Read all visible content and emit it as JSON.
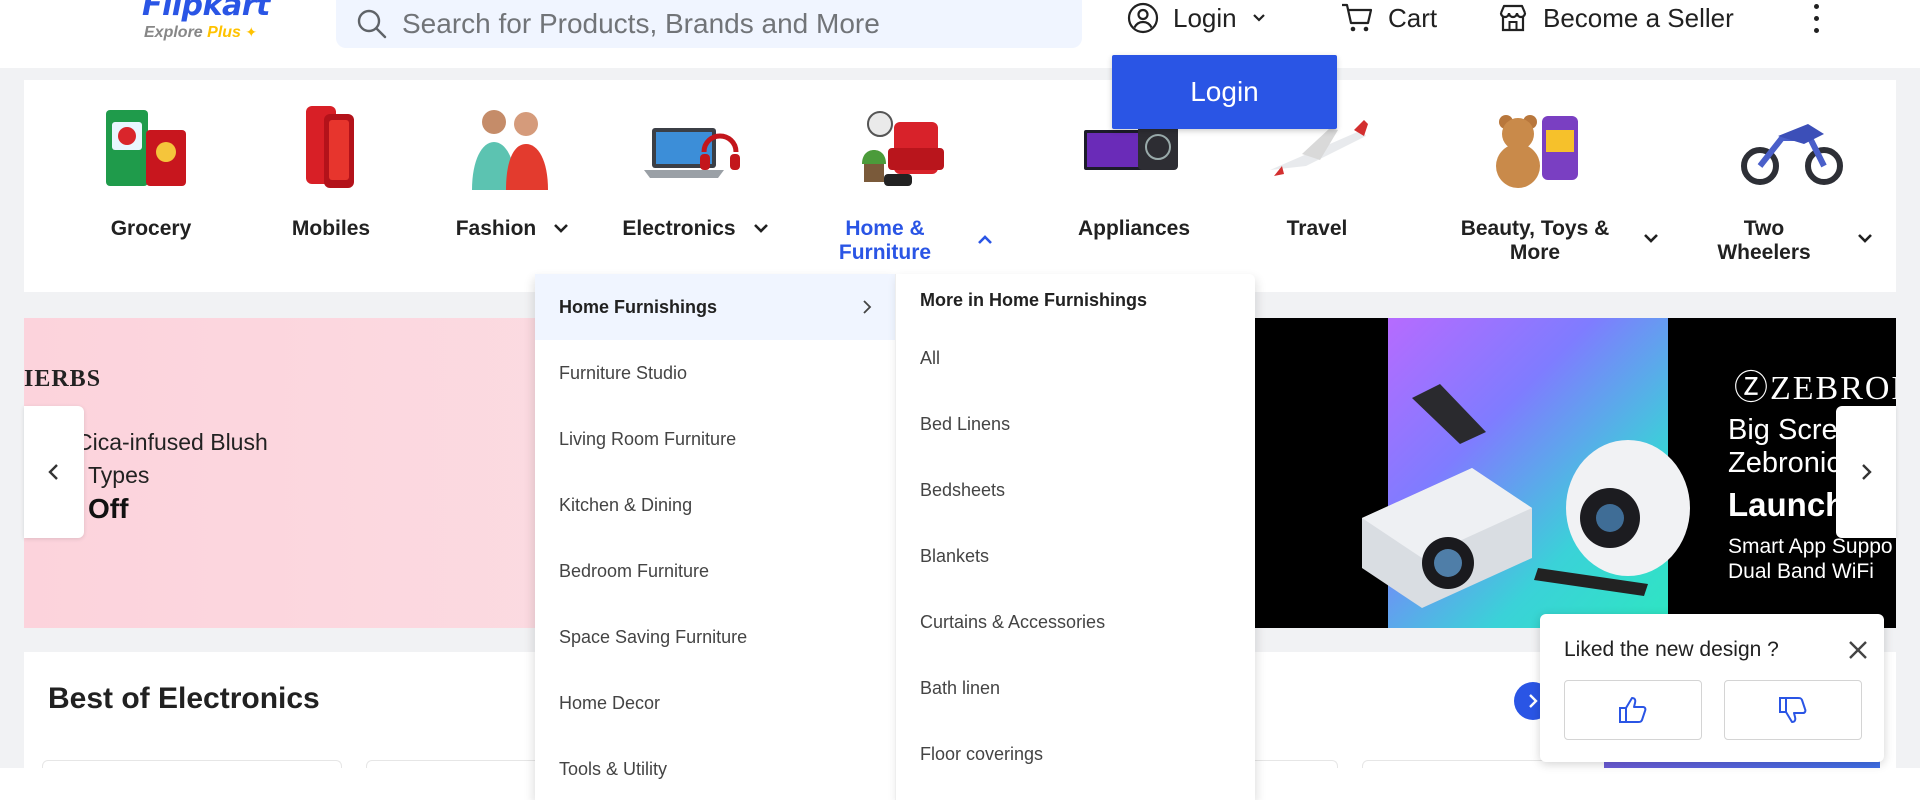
{
  "header": {
    "logo": {
      "brand": "Flipkart",
      "sub_prefix": "Explore",
      "sub_plus": "Plus"
    },
    "search_placeholder": "Search for Products, Brands and More",
    "login_label": "Login",
    "cart_label": "Cart",
    "seller_label": "Become a Seller",
    "login_popup_label": "Login"
  },
  "categories": [
    {
      "label": "Grocery"
    },
    {
      "label": "Mobiles"
    },
    {
      "label": "Fashion"
    },
    {
      "label": "Electronics"
    },
    {
      "label_line1": "Home &",
      "label_line2": "Furniture"
    },
    {
      "label": "Appliances"
    },
    {
      "label": "Travel"
    },
    {
      "label_line1": "Beauty, Toys &",
      "label_line2": "More"
    },
    {
      "label_line1": "Two",
      "label_line2": "Wheelers"
    }
  ],
  "banner": {
    "left_brand": "IERBS",
    "left_line1": "Cica-infused Blush",
    "left_line2": "Types",
    "left_line3": "Off",
    "right_brand": "ZEBRON",
    "right_line1": "Big Scre",
    "right_line2": "Zebronic",
    "right_line3": "Launch",
    "right_line4": "Smart App Suppo",
    "right_line5": "Dual Band WiFi"
  },
  "mega_menu": {
    "left_items": [
      "Home Furnishings",
      "Furniture Studio",
      "Living Room Furniture",
      "Kitchen & Dining",
      "Bedroom Furniture",
      "Space Saving Furniture",
      "Home Decor",
      "Tools & Utility"
    ],
    "right_heading": "More in Home Furnishings",
    "right_items": [
      "All",
      "Bed Linens",
      "Bedsheets",
      "Blankets",
      "Curtains & Accessories",
      "Bath linen",
      "Floor coverings"
    ]
  },
  "section": {
    "title": "Best of Electronics"
  },
  "feedback": {
    "title": "Liked the new design ?"
  },
  "colors": {
    "accent": "#2a55e5",
    "search_bg": "#f0f5ff",
    "page_bg": "#f1f2f4"
  }
}
